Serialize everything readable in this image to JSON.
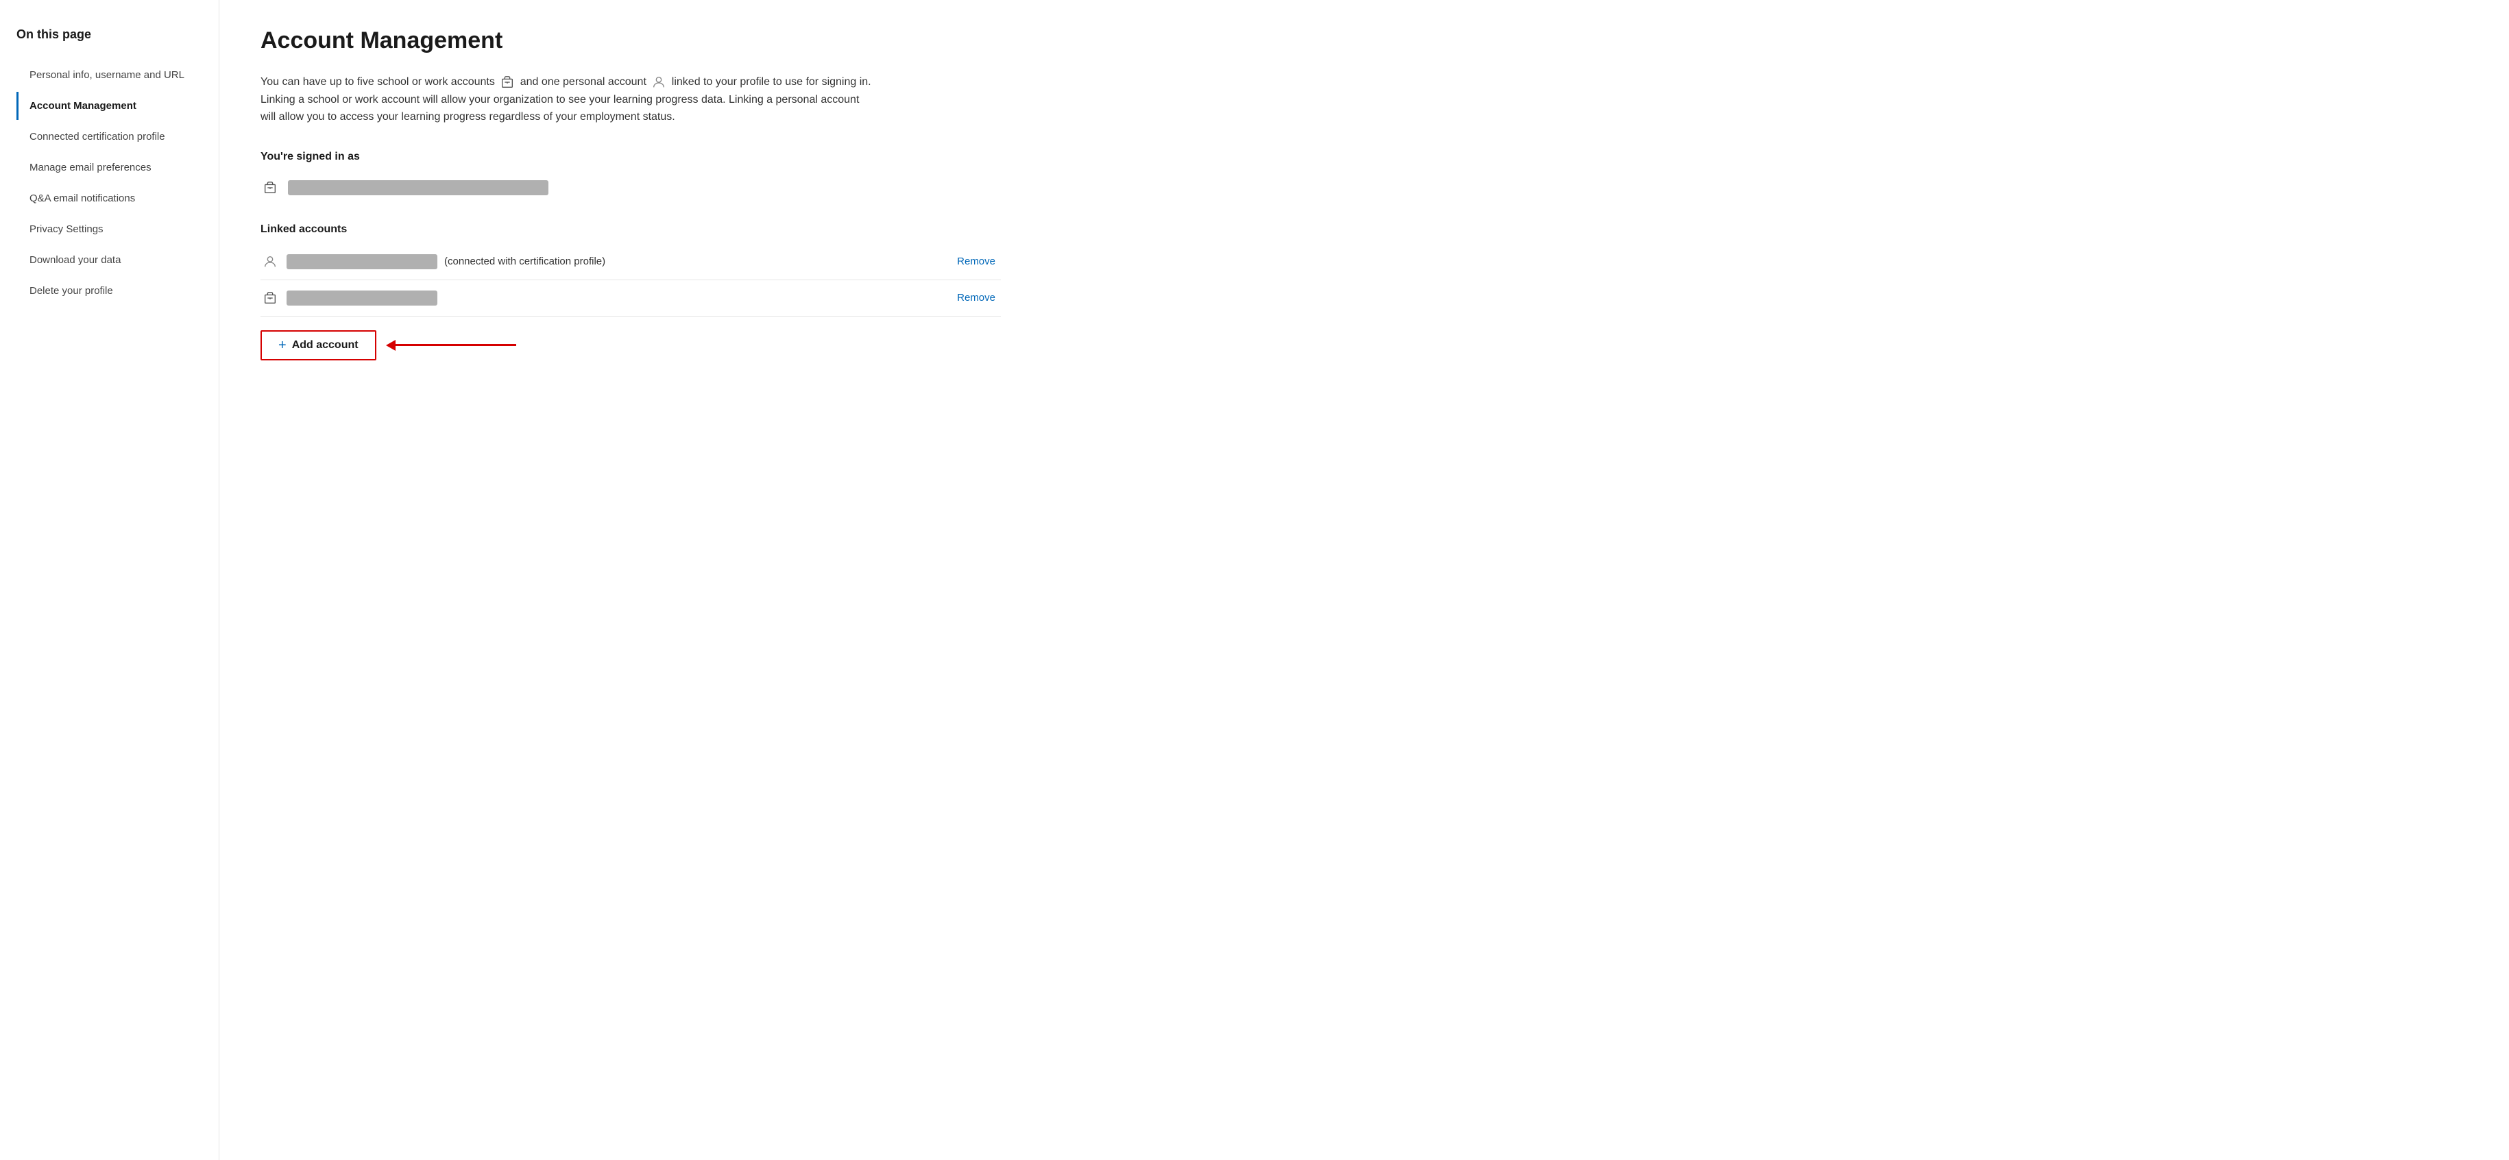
{
  "sidebar": {
    "title": "On this page",
    "items": [
      {
        "id": "personal-info",
        "label": "Personal info, username and URL",
        "active": false
      },
      {
        "id": "account-management",
        "label": "Account Management",
        "active": true
      },
      {
        "id": "connected-certification",
        "label": "Connected certification profile",
        "active": false
      },
      {
        "id": "manage-email",
        "label": "Manage email preferences",
        "active": false
      },
      {
        "id": "qa-email",
        "label": "Q&A email notifications",
        "active": false
      },
      {
        "id": "privacy-settings",
        "label": "Privacy Settings",
        "active": false
      },
      {
        "id": "download-data",
        "label": "Download your data",
        "active": false
      },
      {
        "id": "delete-profile",
        "label": "Delete your profile",
        "active": false
      }
    ]
  },
  "main": {
    "title": "Account Management",
    "description_part1": "You can have up to five school or work accounts",
    "description_part2": "and one personal account",
    "description_part3": "linked to your profile to use for signing in. Linking a school or work account will allow your organization to see your learning progress data. Linking a personal account will allow you to access your learning progress regardless of your employment status.",
    "signed_in_label": "You're signed in as",
    "linked_accounts_label": "Linked accounts",
    "cert_connected_text": "(connected with certification profile)",
    "remove_label": "Remove",
    "add_account_label": "Add account"
  }
}
